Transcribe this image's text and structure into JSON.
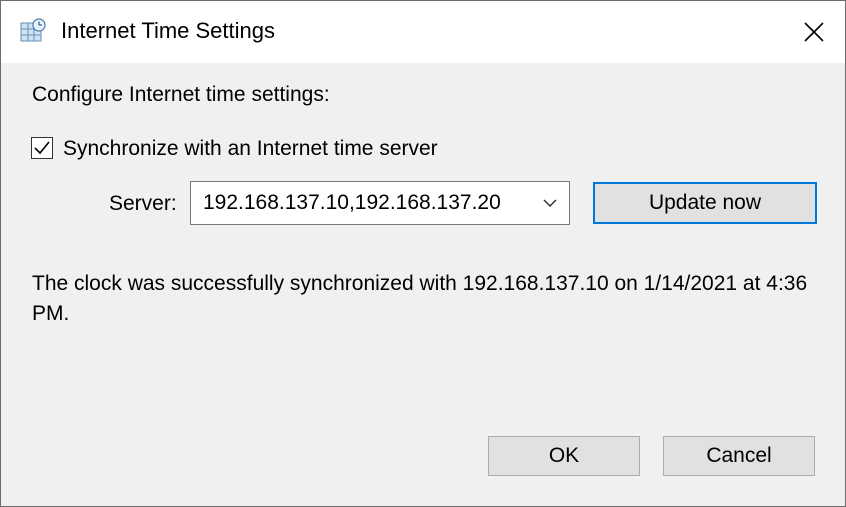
{
  "window": {
    "title": "Internet Time Settings",
    "icon": "clock-globe-icon",
    "close_icon": "close-icon"
  },
  "main": {
    "heading": "Configure Internet time settings:",
    "sync_checkbox": {
      "label": "Synchronize with an Internet time server",
      "checked": true
    },
    "server": {
      "label": "Server:",
      "value": "192.168.137.10,192.168.137.20"
    },
    "update_button": "Update now",
    "status_text": "The clock was successfully synchronized with 192.168.137.10 on 1/14/2021 at 4:36 PM."
  },
  "footer": {
    "ok_label": "OK",
    "cancel_label": "Cancel"
  },
  "colors": {
    "accent": "#0078d7",
    "dialog_bg": "#f0f0f0",
    "button_bg": "#e1e1e1"
  }
}
